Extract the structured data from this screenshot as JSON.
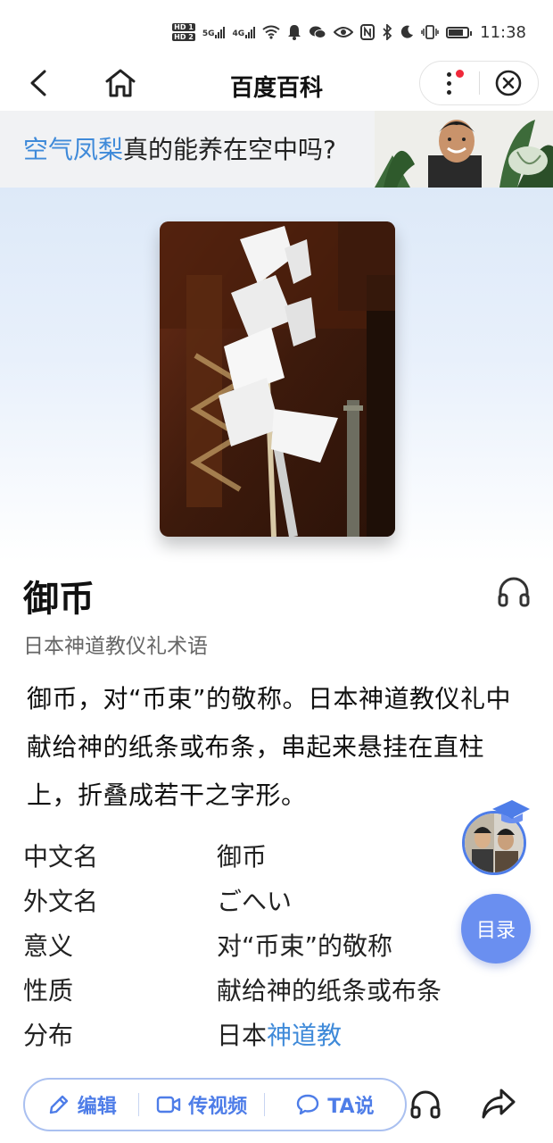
{
  "status_bar": {
    "hd1": "HD 1",
    "hd2": "HD 2",
    "net1": "5G",
    "net2": "4G",
    "time": "11:38",
    "battery_level": 0.8,
    "icons": [
      "wifi-icon",
      "notification-bell-icon",
      "wechat-icon",
      "eye-icon",
      "nfc-icon",
      "bluetooth-icon",
      "moon-icon",
      "vibrate-icon",
      "battery-icon"
    ]
  },
  "nav": {
    "title": "百度百科",
    "icons": [
      "back-icon",
      "home-icon",
      "more-icon",
      "close-icon"
    ],
    "notification_dot_color": "#f0283a"
  },
  "banner": {
    "highlight": "空气凤梨",
    "rest": "真的能养在空中吗?",
    "highlight_color": "#3f8ad9"
  },
  "entry": {
    "title": "御币",
    "subtitle": "日本神道教仪礼术语",
    "summary": "御币，对“币束”的敬称。日本神道教仪礼中献给神的纸条或布条，串起来悬挂在直柱上，折叠成若干之字形。"
  },
  "info_rows": [
    {
      "key": "中文名",
      "value": "御币"
    },
    {
      "key": "外文名",
      "value": "ごへい"
    },
    {
      "key": "意义",
      "value": "对“币束”的敬称"
    },
    {
      "key": "性质",
      "value": "献给神的纸条或布条"
    },
    {
      "key": "分布",
      "value_plain": "日本",
      "value_link": "神道教"
    }
  ],
  "float": {
    "toc_label": "目录",
    "accent": "#6a8ff0"
  },
  "bottom_bar": {
    "edit_label": "编辑",
    "video_label": "传视频",
    "ta_label": "TA说",
    "accent": "#4e7de8"
  }
}
